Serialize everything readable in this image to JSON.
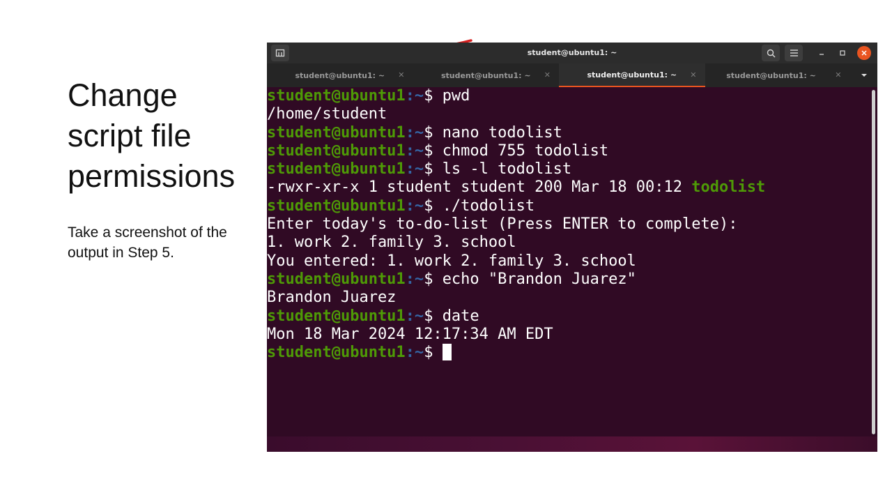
{
  "slide": {
    "title": "Change script file permissions",
    "instruction": "Take a screenshot of the output in Step 5."
  },
  "terminal": {
    "window_title": "student@ubuntu1: ~",
    "tabs": [
      {
        "label": "student@ubuntu1: ~",
        "active": false
      },
      {
        "label": "student@ubuntu1: ~",
        "active": false
      },
      {
        "label": "student@ubuntu1: ~",
        "active": true
      },
      {
        "label": "student@ubuntu1: ~",
        "active": false
      }
    ],
    "prompt_user": "student@ubuntu1",
    "prompt_path": ":~",
    "prompt_symbol": "$ ",
    "lines": [
      {
        "type": "cmd",
        "text": "pwd"
      },
      {
        "type": "out",
        "text": "/home/student"
      },
      {
        "type": "cmd",
        "text": "nano todolist"
      },
      {
        "type": "cmd",
        "text": "chmod 755 todolist"
      },
      {
        "type": "cmd",
        "text": "ls -l todolist"
      },
      {
        "type": "ls",
        "text": "-rwxr-xr-x 1 student student 200 Mar 18 00:12 ",
        "highlight": "todolist"
      },
      {
        "type": "cmd",
        "text": "./todolist"
      },
      {
        "type": "out",
        "text": "Enter today's to-do-list (Press ENTER to complete):"
      },
      {
        "type": "out",
        "text": "1. work 2. family 3. school"
      },
      {
        "type": "out",
        "text": "You entered: 1. work 2. family 3. school"
      },
      {
        "type": "cmd",
        "text": "echo \"Brandon Juarez\""
      },
      {
        "type": "out",
        "text": "Brandon Juarez"
      },
      {
        "type": "cmd",
        "text": "date"
      },
      {
        "type": "out",
        "text": "Mon 18 Mar 2024 12:17:34 AM EDT"
      },
      {
        "type": "cursor",
        "text": ""
      }
    ]
  },
  "icons": {
    "new_tab": "new-tab-icon",
    "search": "search-icon",
    "menu": "hamburger-menu-icon",
    "minimize": "minimize-icon",
    "maximize": "maximize-icon",
    "close": "close-icon",
    "tab_close": "tab-close-icon",
    "tabs_dropdown": "chevron-down-icon"
  },
  "colors": {
    "terminal_bg": "#300a24",
    "prompt_user": "#4e9a06",
    "prompt_path": "#3465a4",
    "accent": "#e95420",
    "pen_mark": "#d62020"
  }
}
